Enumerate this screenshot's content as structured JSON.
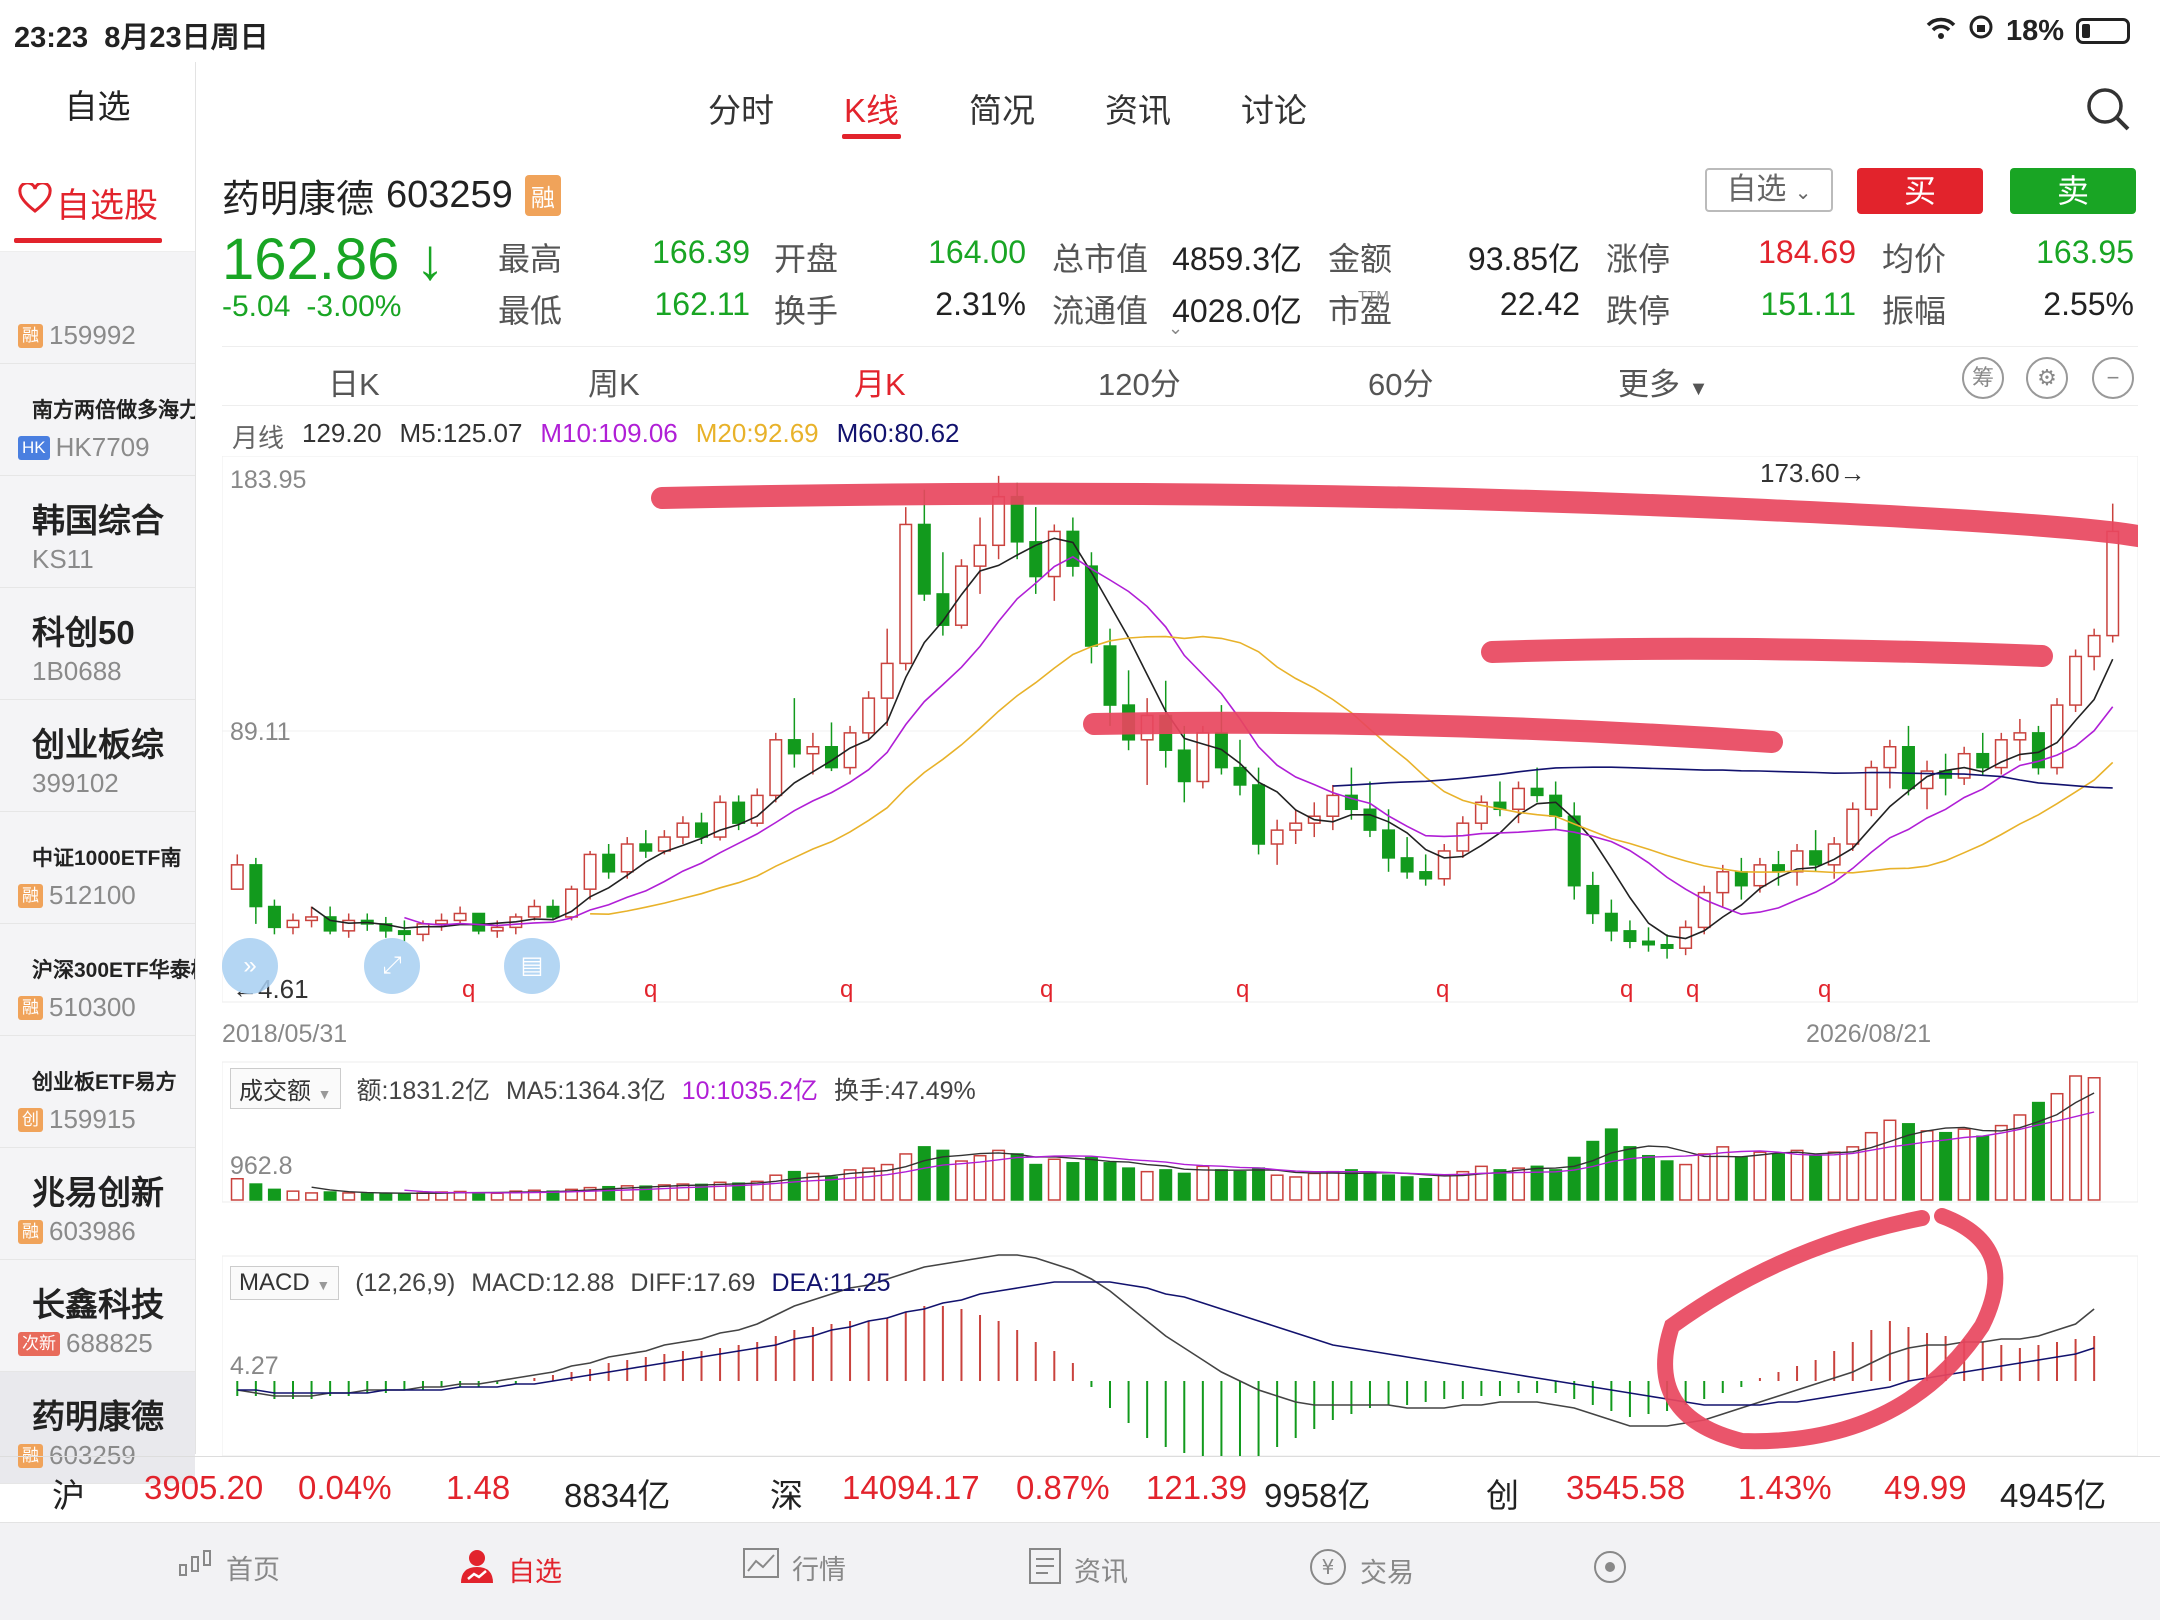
{
  "status": {
    "time": "23:23",
    "date": "8月23日周日",
    "battery": "18%"
  },
  "sidebar": {
    "title": "自选",
    "tab": "自选股",
    "items": [
      {
        "name": "",
        "tag": "融",
        "tagc": "o",
        "code": "159992",
        "small": false
      },
      {
        "name": "南方两倍做多海力",
        "tag": "HK",
        "tagc": "b",
        "code": "HK7709",
        "small": true
      },
      {
        "name": "韩国综合",
        "tag": "",
        "tagc": "",
        "code": "KS11",
        "small": false
      },
      {
        "name": "科创50",
        "tag": "",
        "tagc": "",
        "code": "1B0688",
        "small": false
      },
      {
        "name": "创业板综",
        "tag": "",
        "tagc": "",
        "code": "399102",
        "small": false
      },
      {
        "name": "中证1000ETF南",
        "tag": "融",
        "tagc": "o",
        "code": "512100",
        "small": true
      },
      {
        "name": "沪深300ETF华泰柏",
        "tag": "融",
        "tagc": "o",
        "code": "510300",
        "small": true
      },
      {
        "name": "创业板ETF易方",
        "tag": "创",
        "tagc": "o",
        "code": "159915",
        "small": true
      },
      {
        "name": "兆易创新",
        "tag": "融",
        "tagc": "o",
        "code": "603986",
        "small": false
      },
      {
        "name": "长鑫科技",
        "tag": "次新",
        "tagc": "r",
        "code": "688825",
        "small": false
      },
      {
        "name": "药明康德",
        "tag": "融",
        "tagc": "o",
        "code": "603259",
        "small": false
      }
    ]
  },
  "tabs": [
    "分时",
    "K线",
    "简况",
    "资讯",
    "讨论"
  ],
  "stock": {
    "name": "药明康德",
    "code": "603259",
    "badge": "融",
    "price": "162.86",
    "arrow": "↓",
    "change": "-5.04",
    "pct": "-3.00%",
    "btn_watch": "自选",
    "btn_buy": "买",
    "btn_sell": "卖"
  },
  "quote": {
    "r1": [
      {
        "l": "最高",
        "v": "166.39",
        "c": "g"
      },
      {
        "l": "开盘",
        "v": "164.00",
        "c": "g"
      },
      {
        "l": "总市值",
        "v": "4859.3亿",
        "c": "k"
      },
      {
        "l": "金额",
        "v": "93.85亿",
        "c": "k"
      },
      {
        "l": "涨停",
        "v": "184.69",
        "c": "r"
      },
      {
        "l": "均价",
        "v": "163.95",
        "c": "g"
      }
    ],
    "r2": [
      {
        "l": "最低",
        "v": "162.11",
        "c": "g"
      },
      {
        "l": "换手",
        "v": "2.31%",
        "c": "k"
      },
      {
        "l": "流通值",
        "v": "4028.0亿",
        "c": "k"
      },
      {
        "l": "市盈",
        "v": "22.42",
        "c": "k"
      },
      {
        "l": "跌停",
        "v": "151.11",
        "c": "g"
      },
      {
        "l": "振幅",
        "v": "2.55%",
        "c": "k"
      }
    ],
    "ttm": "TTM"
  },
  "periods": [
    "日K",
    "周K",
    "月K",
    "120分",
    "60分",
    "更多"
  ],
  "period_icons": {
    "chip": "筹",
    "gear": "⚙",
    "zoom": "−"
  },
  "ma": {
    "label": "月线",
    "close": "129.20",
    "m5": "M5:125.07",
    "m10": "M10:109.06",
    "m20": "M20:92.69",
    "m60": "M60:80.62"
  },
  "ma_colors": {
    "m5": "#222222",
    "m10": "#b01fd6",
    "m20": "#e8b22a",
    "m60": "#12126e"
  },
  "kline_labels": {
    "ymax": "183.95",
    "ymid": "89.11",
    "ymin": "4.61",
    "hi": "173.60→",
    "date_start": "2018/05/31",
    "date_end": "2026/08/21",
    "q": "q"
  },
  "volume": {
    "sel": "成交额",
    "amt": "额:1831.2亿",
    "ma5": "MA5:1364.3亿",
    "ma10": "10:1035.2亿",
    "turn": "换手:47.49%",
    "ylabel": "962.8"
  },
  "macd": {
    "sel": "MACD",
    "params": "(12,26,9)",
    "macd": "MACD:12.88",
    "diff": "DIFF:17.69",
    "dea": "DEA:11.25",
    "ylabel": "4.27"
  },
  "index_bar": {
    "sh": {
      "name": "沪",
      "v": "3905.20",
      "p": "0.04%",
      "c": "1.48",
      "a": "8834亿"
    },
    "sz": {
      "name": "深",
      "v": "14094.17",
      "p": "0.87%",
      "c": "121.39",
      "a": "9958亿"
    },
    "cy": {
      "name": "创",
      "v": "3545.58",
      "p": "1.43%",
      "c": "49.99",
      "a": "4945亿"
    }
  },
  "nav": [
    "首页",
    "自选",
    "行情",
    "资讯",
    "交易"
  ],
  "chart_data": {
    "type": "candlestick",
    "period": "月线",
    "x_range": [
      "2018/05/31",
      "2026/08/21"
    ],
    "ylim": [
      4.61,
      183.95
    ],
    "candles": [
      [
        65,
        75,
        70,
        72
      ],
      [
        72,
        74,
        55,
        60
      ],
      [
        60,
        62,
        52,
        54
      ],
      [
        54,
        58,
        52,
        56
      ],
      [
        56,
        60,
        54,
        57
      ],
      [
        57,
        60,
        52,
        53
      ],
      [
        53,
        58,
        51,
        56
      ],
      [
        56,
        58,
        53,
        55
      ],
      [
        55,
        57,
        51,
        53
      ],
      [
        53,
        56,
        50,
        52
      ],
      [
        52,
        56,
        50,
        55
      ],
      [
        55,
        58,
        53,
        56
      ],
      [
        56,
        60,
        55,
        58
      ],
      [
        58,
        58,
        52,
        53
      ],
      [
        53,
        56,
        51,
        54
      ],
      [
        54,
        58,
        52,
        57
      ],
      [
        57,
        62,
        56,
        60
      ],
      [
        60,
        62,
        56,
        57
      ],
      [
        57,
        66,
        56,
        65
      ],
      [
        65,
        76,
        62,
        75
      ],
      [
        75,
        78,
        68,
        70
      ],
      [
        70,
        80,
        68,
        78
      ],
      [
        78,
        82,
        74,
        76
      ],
      [
        76,
        82,
        75,
        80
      ],
      [
        80,
        86,
        78,
        84
      ],
      [
        84,
        87,
        78,
        80
      ],
      [
        80,
        92,
        79,
        90
      ],
      [
        90,
        92,
        82,
        84
      ],
      [
        84,
        94,
        83,
        92
      ],
      [
        92,
        110,
        90,
        108
      ],
      [
        108,
        120,
        100,
        104
      ],
      [
        104,
        110,
        98,
        106
      ],
      [
        106,
        113,
        99,
        100
      ],
      [
        100,
        112,
        98,
        110
      ],
      [
        110,
        122,
        108,
        120
      ],
      [
        120,
        140,
        112,
        130
      ],
      [
        130,
        175,
        128,
        170
      ],
      [
        170,
        180,
        148,
        150
      ],
      [
        150,
        162,
        138,
        141
      ],
      [
        141,
        160,
        140,
        158
      ],
      [
        158,
        172,
        150,
        164
      ],
      [
        164,
        184,
        160,
        178
      ],
      [
        178,
        182,
        160,
        165
      ],
      [
        165,
        175,
        150,
        155
      ],
      [
        155,
        170,
        148,
        168
      ],
      [
        168,
        172,
        155,
        158
      ],
      [
        158,
        162,
        130,
        135
      ],
      [
        135,
        140,
        112,
        118
      ],
      [
        118,
        128,
        105,
        108
      ],
      [
        108,
        120,
        95,
        115
      ],
      [
        115,
        125,
        100,
        105
      ],
      [
        105,
        112,
        90,
        96
      ],
      [
        96,
        112,
        94,
        110
      ],
      [
        110,
        118,
        98,
        100
      ],
      [
        100,
        108,
        92,
        95
      ],
      [
        95,
        100,
        75,
        78
      ],
      [
        78,
        85,
        72,
        82
      ],
      [
        82,
        88,
        78,
        84
      ],
      [
        84,
        90,
        80,
        86
      ],
      [
        86,
        95,
        82,
        92
      ],
      [
        92,
        100,
        85,
        88
      ],
      [
        88,
        96,
        80,
        82
      ],
      [
        82,
        88,
        70,
        74
      ],
      [
        74,
        80,
        68,
        70
      ],
      [
        70,
        75,
        66,
        68
      ],
      [
        68,
        78,
        66,
        76
      ],
      [
        76,
        86,
        74,
        84
      ],
      [
        84,
        92,
        82,
        90
      ],
      [
        90,
        96,
        86,
        88
      ],
      [
        88,
        96,
        84,
        94
      ],
      [
        94,
        100,
        90,
        92
      ],
      [
        92,
        96,
        82,
        86
      ],
      [
        86,
        90,
        62,
        66
      ],
      [
        66,
        70,
        55,
        58
      ],
      [
        58,
        62,
        50,
        53
      ],
      [
        53,
        56,
        48,
        50
      ],
      [
        50,
        54,
        47,
        49
      ],
      [
        49,
        52,
        45,
        48
      ],
      [
        48,
        56,
        46,
        54
      ],
      [
        54,
        66,
        52,
        64
      ],
      [
        64,
        72,
        60,
        70
      ],
      [
        70,
        74,
        62,
        66
      ],
      [
        66,
        74,
        64,
        72
      ],
      [
        72,
        76,
        66,
        70
      ],
      [
        70,
        78,
        66,
        76
      ],
      [
        76,
        82,
        70,
        72
      ],
      [
        72,
        80,
        68,
        78
      ],
      [
        78,
        90,
        76,
        88
      ],
      [
        88,
        102,
        86,
        100
      ],
      [
        100,
        108,
        94,
        106
      ],
      [
        106,
        112,
        92,
        94
      ],
      [
        94,
        102,
        88,
        99
      ],
      [
        99,
        104,
        92,
        97
      ],
      [
        97,
        106,
        95,
        104
      ],
      [
        104,
        110,
        98,
        100
      ],
      [
        100,
        110,
        98,
        108
      ],
      [
        108,
        114,
        102,
        110
      ],
      [
        110,
        112,
        98,
        100
      ],
      [
        100,
        120,
        98,
        118
      ],
      [
        118,
        134,
        116,
        132
      ],
      [
        132,
        140,
        128,
        138
      ],
      [
        138,
        176,
        136,
        168
      ]
    ],
    "volume": [
      120,
      90,
      60,
      50,
      40,
      45,
      40,
      35,
      38,
      35,
      40,
      45,
      48,
      40,
      38,
      50,
      55,
      50,
      60,
      70,
      75,
      80,
      78,
      85,
      90,
      88,
      100,
      95,
      105,
      140,
      160,
      150,
      130,
      170,
      180,
      200,
      260,
      300,
      280,
      220,
      250,
      280,
      260,
      200,
      230,
      210,
      240,
      210,
      180,
      160,
      170,
      150,
      190,
      170,
      160,
      180,
      140,
      130,
      150,
      160,
      170,
      150,
      140,
      130,
      120,
      140,
      160,
      190,
      170,
      180,
      190,
      170,
      240,
      330,
      400,
      300,
      250,
      220,
      200,
      260,
      300,
      240,
      270,
      260,
      280,
      250,
      270,
      300,
      380,
      450,
      430,
      390,
      380,
      400,
      360,
      420,
      480,
      550,
      600,
      700,
      690
    ],
    "macd_hist": [
      -5,
      -5,
      -6,
      -6,
      -6,
      -5,
      -5,
      -4,
      -4,
      -3,
      -3,
      -2,
      -2,
      -2,
      -1,
      -1,
      1,
      2,
      3,
      4,
      6,
      7,
      8,
      9,
      10,
      10,
      11,
      12,
      13,
      15,
      17,
      18,
      19,
      20,
      20,
      21,
      23,
      25,
      25,
      24,
      22,
      20,
      17,
      13,
      10,
      6,
      -2,
      -9,
      -14,
      -19,
      -22,
      -24,
      -25,
      -26,
      -26,
      -25,
      -22,
      -19,
      -16,
      -13,
      -11,
      -9,
      -8,
      -8,
      -7,
      -6,
      -6,
      -5,
      -5,
      -4,
      -4,
      -4,
      -6,
      -8,
      -10,
      -12,
      -11,
      -10,
      -8,
      -6,
      -4,
      -2,
      1,
      3,
      5,
      7,
      10,
      13,
      17,
      20,
      18,
      16,
      15,
      14,
      13,
      12,
      11,
      12,
      13,
      14,
      15
    ],
    "macd_diff": [
      -3,
      -4,
      -5,
      -5,
      -5,
      -4,
      -4,
      -3,
      -3,
      -3,
      -2,
      -2,
      -1,
      -1,
      0,
      1,
      2,
      3,
      5,
      6,
      8,
      9,
      10,
      12,
      13,
      14,
      16,
      17,
      19,
      22,
      25,
      27,
      29,
      31,
      32,
      34,
      36,
      38,
      39,
      40,
      41,
      42,
      42,
      41,
      39,
      37,
      34,
      30,
      25,
      20,
      15,
      11,
      7,
      3,
      0,
      -3,
      -5,
      -7,
      -8,
      -8,
      -8,
      -8,
      -8,
      -9,
      -9,
      -9,
      -8,
      -8,
      -7,
      -7,
      -7,
      -8,
      -9,
      -11,
      -13,
      -15,
      -15,
      -15,
      -14,
      -13,
      -11,
      -9,
      -7,
      -5,
      -3,
      -1,
      1,
      3,
      6,
      9,
      11,
      12,
      12,
      13,
      13,
      14,
      14,
      15,
      17,
      19,
      24
    ],
    "macd_dea": [
      -3,
      -3,
      -4,
      -4,
      -4,
      -4,
      -4,
      -4,
      -3,
      -3,
      -3,
      -3,
      -2,
      -2,
      -2,
      -1,
      -1,
      0,
      1,
      2,
      3,
      4,
      5,
      6,
      7,
      8,
      9,
      10,
      11,
      12,
      14,
      15,
      17,
      18,
      20,
      21,
      23,
      24,
      26,
      27,
      29,
      30,
      31,
      32,
      33,
      33,
      33,
      33,
      32,
      31,
      29,
      28,
      26,
      24,
      22,
      20,
      18,
      16,
      14,
      12,
      11,
      10,
      9,
      8,
      7,
      6,
      5,
      4,
      3,
      2,
      1,
      0,
      -1,
      -2,
      -3,
      -4,
      -5,
      -6,
      -7,
      -8,
      -8,
      -8,
      -8,
      -7,
      -7,
      -6,
      -5,
      -4,
      -3,
      -2,
      0,
      1,
      2,
      3,
      4,
      5,
      6,
      7,
      8,
      9,
      11
    ]
  }
}
